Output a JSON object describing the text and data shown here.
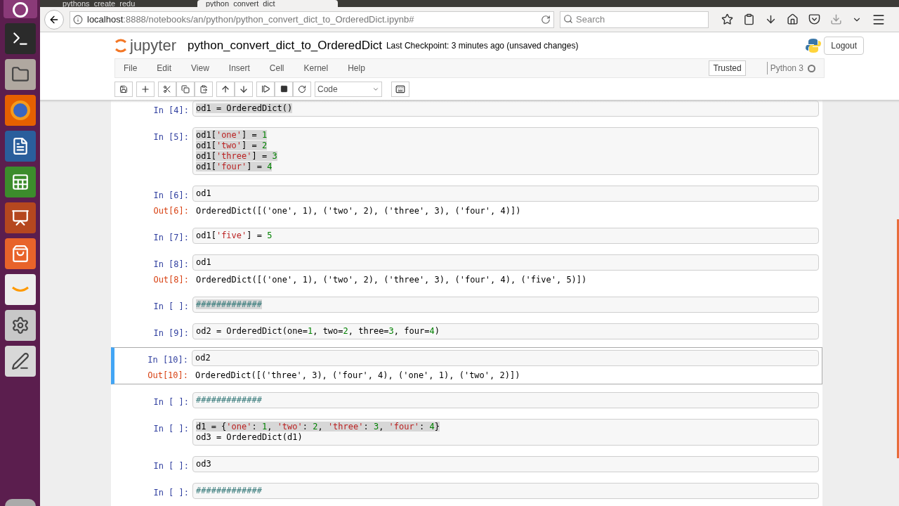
{
  "browser": {
    "tabs": [
      {
        "title": "pythons_create_redu",
        "selected": false
      },
      {
        "title": "python_convert_dict_",
        "selected": true
      }
    ],
    "url_host": "localhost",
    "url_rest": ":8888/notebooks/an/python/python_convert_dict_to_OrderedDict.ipynb#",
    "search": {
      "placeholder": "Search"
    }
  },
  "header": {
    "logo_text": "jupyter",
    "notebook_name": "python_convert_dict_to_OrderedDict",
    "checkpoint": "Last Checkpoint: 3 minutes ago (unsaved changes)",
    "logout": "Logout"
  },
  "menu": [
    "File",
    "Edit",
    "View",
    "Insert",
    "Cell",
    "Kernel",
    "Help"
  ],
  "trusted": "Trusted",
  "kernel": {
    "name": "Python 3",
    "busy": false
  },
  "cell_type": "Code",
  "cells": [
    {
      "prompt": "In [4]:",
      "selected": false,
      "lines": [
        {
          "highlighted": true,
          "tokens": [
            {
              "kind": "plain",
              "text": "od1 = OrderedDict()"
            }
          ]
        }
      ]
    },
    {
      "prompt": "In [5]:",
      "selected": false,
      "lines": [
        {
          "highlighted": true,
          "tokens": [
            {
              "kind": "plain",
              "text": "od1["
            },
            {
              "kind": "string",
              "text": "'one'"
            },
            {
              "kind": "plain",
              "text": "] = "
            },
            {
              "kind": "number",
              "text": "1"
            }
          ]
        },
        {
          "highlighted": true,
          "tokens": [
            {
              "kind": "plain",
              "text": "od1["
            },
            {
              "kind": "string",
              "text": "'two'"
            },
            {
              "kind": "plain",
              "text": "] = "
            },
            {
              "kind": "number",
              "text": "2"
            }
          ]
        },
        {
          "highlighted": true,
          "tokens": [
            {
              "kind": "plain",
              "text": "od1["
            },
            {
              "kind": "string",
              "text": "'three'"
            },
            {
              "kind": "plain",
              "text": "] = "
            },
            {
              "kind": "number",
              "text": "3"
            }
          ]
        },
        {
          "highlighted": true,
          "tokens": [
            {
              "kind": "plain",
              "text": "od1["
            },
            {
              "kind": "string",
              "text": "'four'"
            },
            {
              "kind": "plain",
              "text": "] = "
            },
            {
              "kind": "number",
              "text": "4"
            }
          ]
        }
      ]
    },
    {
      "prompt": "In [6]:",
      "selected": false,
      "lines": [
        {
          "highlighted": false,
          "tokens": [
            {
              "kind": "plain",
              "text": "od1"
            }
          ]
        }
      ],
      "output": {
        "prompt": "Out[6]:",
        "text": "OrderedDict([('one', 1), ('two', 2), ('three', 3), ('four', 4)])"
      }
    },
    {
      "prompt": "In [7]:",
      "selected": false,
      "lines": [
        {
          "highlighted": false,
          "tokens": [
            {
              "kind": "plain",
              "text": "od1["
            },
            {
              "kind": "string",
              "text": "'five'"
            },
            {
              "kind": "plain",
              "text": "] = "
            },
            {
              "kind": "number",
              "text": "5"
            }
          ]
        }
      ]
    },
    {
      "prompt": "In [8]:",
      "selected": false,
      "lines": [
        {
          "highlighted": false,
          "tokens": [
            {
              "kind": "plain",
              "text": "od1"
            }
          ]
        }
      ],
      "output": {
        "prompt": "Out[8]:",
        "text": "OrderedDict([('one', 1), ('two', 2), ('three', 3), ('four', 4), ('five', 5)])"
      }
    },
    {
      "prompt": "In [ ]:",
      "selected": false,
      "lines": [
        {
          "highlighted": true,
          "tokens": [
            {
              "kind": "comment",
              "text": "#############"
            }
          ]
        }
      ]
    },
    {
      "prompt": "In [9]:",
      "selected": false,
      "lines": [
        {
          "highlighted": false,
          "tokens": [
            {
              "kind": "plain",
              "text": "od2 = OrderedDict(one="
            },
            {
              "kind": "number",
              "text": "1"
            },
            {
              "kind": "plain",
              "text": ", two="
            },
            {
              "kind": "number",
              "text": "2"
            },
            {
              "kind": "plain",
              "text": ", three="
            },
            {
              "kind": "number",
              "text": "3"
            },
            {
              "kind": "plain",
              "text": ", four="
            },
            {
              "kind": "number",
              "text": "4"
            },
            {
              "kind": "plain",
              "text": ")"
            }
          ]
        }
      ]
    },
    {
      "prompt": "In [10]:",
      "selected": true,
      "lines": [
        {
          "highlighted": false,
          "tokens": [
            {
              "kind": "plain",
              "text": "od2"
            }
          ]
        }
      ],
      "output": {
        "prompt": "Out[10]:",
        "text": "OrderedDict([('three', 3), ('four', 4), ('one', 1), ('two', 2)])"
      }
    },
    {
      "prompt": "In [ ]:",
      "selected": false,
      "lines": [
        {
          "highlighted": false,
          "tokens": [
            {
              "kind": "comment",
              "text": "#############"
            }
          ]
        }
      ]
    },
    {
      "prompt": "In [ ]:",
      "selected": false,
      "lines": [
        {
          "highlighted": true,
          "tokens": [
            {
              "kind": "plain",
              "text": "d1 = {"
            },
            {
              "kind": "string",
              "text": "'one'"
            },
            {
              "kind": "plain",
              "text": ": "
            },
            {
              "kind": "number",
              "text": "1"
            },
            {
              "kind": "plain",
              "text": ", "
            },
            {
              "kind": "string",
              "text": "'two'"
            },
            {
              "kind": "plain",
              "text": ": "
            },
            {
              "kind": "number",
              "text": "2"
            },
            {
              "kind": "plain",
              "text": ", "
            },
            {
              "kind": "string",
              "text": "'three'"
            },
            {
              "kind": "plain",
              "text": ": "
            },
            {
              "kind": "number",
              "text": "3"
            },
            {
              "kind": "plain",
              "text": ", "
            },
            {
              "kind": "string",
              "text": "'four'"
            },
            {
              "kind": "plain",
              "text": ": "
            },
            {
              "kind": "number",
              "text": "4"
            },
            {
              "kind": "plain",
              "text": "}"
            }
          ]
        },
        {
          "highlighted": false,
          "tokens": [
            {
              "kind": "plain",
              "text": "od3 = OrderedDict(d1)"
            }
          ]
        }
      ]
    },
    {
      "prompt": "In [ ]:",
      "selected": false,
      "lines": [
        {
          "highlighted": false,
          "tokens": [
            {
              "kind": "plain",
              "text": "od3"
            }
          ]
        }
      ]
    },
    {
      "prompt": "In [ ]:",
      "selected": false,
      "lines": [
        {
          "highlighted": false,
          "tokens": [
            {
              "kind": "comment",
              "text": "#############"
            }
          ]
        }
      ]
    }
  ]
}
